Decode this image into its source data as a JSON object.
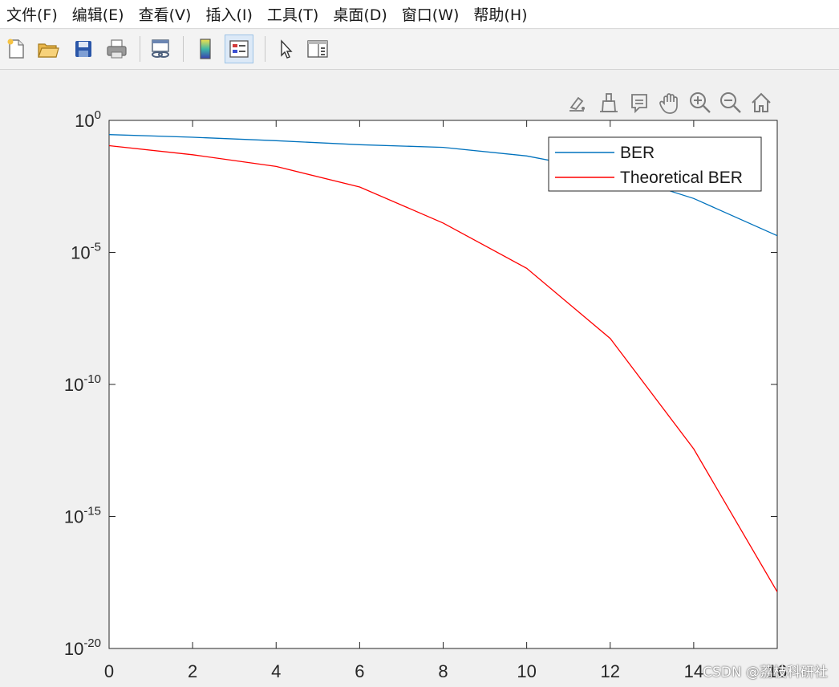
{
  "menu": {
    "items": [
      "文件(F)",
      "编辑(E)",
      "查看(V)",
      "插入(I)",
      "工具(T)",
      "桌面(D)",
      "窗口(W)",
      "帮助(H)"
    ]
  },
  "toolbar": {
    "icons": [
      "new-file-icon",
      "open-folder-icon",
      "save-icon",
      "print-icon",
      "link-plot-icon",
      "colorbar-icon",
      "legend-icon",
      "select-arrow-icon",
      "property-inspector-icon"
    ],
    "active": "legend-icon"
  },
  "axes_toolbar": {
    "icons": [
      "brush-edit-icon",
      "data-brush-icon",
      "data-tips-icon",
      "pan-hand-icon",
      "zoom-in-icon",
      "zoom-out-icon",
      "home-icon"
    ]
  },
  "watermark": "CSDN @荔枝科研社",
  "colors": {
    "ber": "#0072bd",
    "theoretical": "#ff0000",
    "axis": "#262626"
  },
  "chart_data": {
    "type": "line",
    "title": "",
    "xlabel": "",
    "ylabel": "",
    "xlim": [
      0,
      16
    ],
    "ylim_log10": [
      -20,
      0
    ],
    "yscale": "log",
    "grid": false,
    "legend_placement": "top-right",
    "x_ticks": [
      0,
      2,
      4,
      6,
      8,
      10,
      12,
      14,
      16
    ],
    "x_tick_labels": [
      "0",
      "2",
      "4",
      "6",
      "8",
      "10",
      "12",
      "14",
      "16"
    ],
    "y_ticks_log10": [
      0,
      -5,
      -10,
      -15,
      -20
    ],
    "y_tick_labels": [
      {
        "base": "10",
        "exp": "0"
      },
      {
        "base": "10",
        "exp": "-5"
      },
      {
        "base": "10",
        "exp": "-10"
      },
      {
        "base": "10",
        "exp": "-15"
      },
      {
        "base": "10",
        "exp": "-20"
      }
    ],
    "x": [
      0,
      2,
      4,
      6,
      8,
      10,
      12,
      14,
      16
    ],
    "series": [
      {
        "name": "BER",
        "color": "#0072bd",
        "values": [
          0.29,
          0.23,
          0.17,
          0.12,
          0.095,
          0.045,
          0.011,
          0.0011,
          4.3e-05
        ]
      },
      {
        "name": "Theoretical BER",
        "color": "#ff0000",
        "values": [
          0.11,
          0.05,
          0.018,
          0.003,
          0.00013,
          2.5e-06,
          5.5e-09,
          3.6e-13,
          1.4e-18
        ]
      }
    ]
  }
}
